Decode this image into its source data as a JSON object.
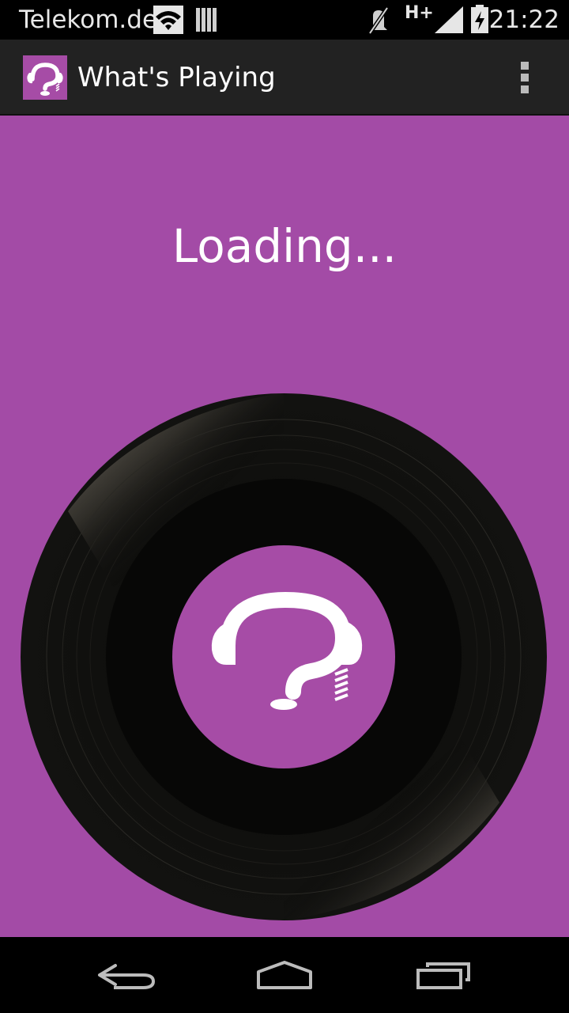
{
  "status_bar": {
    "carrier": "Telekom.de",
    "network_type": "H+",
    "time": "21:22",
    "icons": [
      "wifi-icon",
      "storage-icon",
      "mute-icon",
      "signal-icon",
      "battery-charging-icon"
    ]
  },
  "action_bar": {
    "title": "What's Playing",
    "app_icon": "headphones-question-icon",
    "menu_icon": "overflow-menu-icon"
  },
  "main": {
    "status_text": "Loading...",
    "image": "vinyl-record-icon"
  },
  "nav_bar": {
    "buttons": [
      "back-icon",
      "home-icon",
      "recents-icon"
    ]
  },
  "colors": {
    "background": "#a34ba6",
    "action_bar": "#222222",
    "status_bar": "#000000",
    "record": "#080806"
  }
}
